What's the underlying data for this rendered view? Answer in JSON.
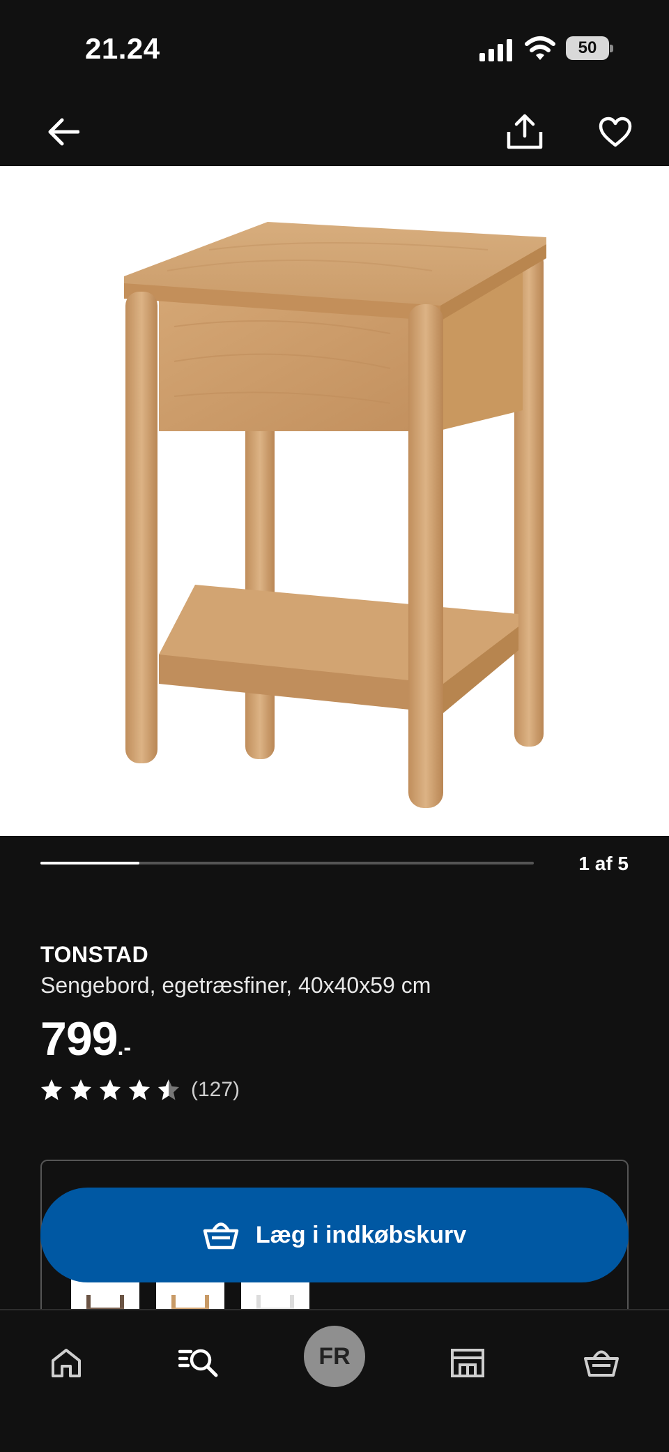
{
  "status_bar": {
    "time": "21.24",
    "battery": "50"
  },
  "top_nav": {
    "back_icon": "arrow-left-icon",
    "share_icon": "share-icon",
    "favourite_icon": "heart-icon"
  },
  "gallery": {
    "counter": "1 af 5",
    "current": 1,
    "total": 5
  },
  "product": {
    "name": "TONSTAD",
    "description": "Sengebord, egetræsfiner, 40x40x59 cm",
    "price": "799",
    "price_suffix": ".-",
    "rating": 4.5,
    "rating_max": 5,
    "review_count": "(127)"
  },
  "cart_button": {
    "label": "Læg i indkøbskurv",
    "icon": "basket-icon"
  },
  "variants": [
    {
      "name": "dark-brown"
    },
    {
      "name": "oak"
    },
    {
      "name": "white"
    }
  ],
  "bottom_nav": {
    "items": [
      {
        "icon": "home-icon"
      },
      {
        "icon": "search-icon"
      },
      {
        "avatar": "FR"
      },
      {
        "icon": "store-icon"
      },
      {
        "icon": "basket-icon"
      }
    ]
  },
  "colors": {
    "background": "#111111",
    "accent": "#0058a3",
    "text": "#ffffff"
  }
}
